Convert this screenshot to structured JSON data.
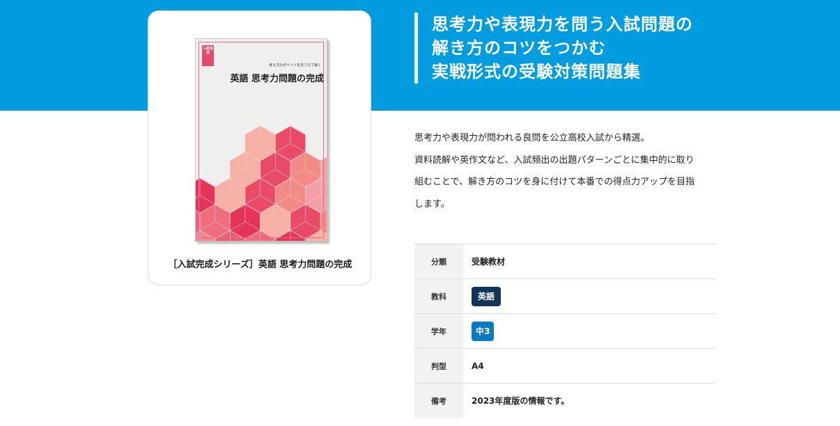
{
  "headline": {
    "lines": [
      "思考力や表現力を問う入試問題の",
      "解き方のコツをつかむ",
      "実戦形式の受験対策問題集"
    ]
  },
  "product": {
    "caption": "［入試完成シリーズ］英語 思考力問題の完成",
    "cover": {
      "series_badge": "入試完成",
      "subtitle": "考え方のポイントをおさえて解く",
      "title": "英語  思考力問題の完成"
    }
  },
  "description": {
    "lines": [
      "思考力や表現力が問われる良問を公立高校入試から精選。",
      "資料読解や英作文など、入試頻出の出題パターンごとに集中的に取り",
      "組むことで、解き方のコツを身に付けて本番での得点力アップを目指",
      "します。"
    ]
  },
  "specs": {
    "category": {
      "label": "分類",
      "value": "受験教材"
    },
    "subject": {
      "label": "教科",
      "value": "英語"
    },
    "grade": {
      "label": "学年",
      "value": "中3"
    },
    "format": {
      "label": "判型",
      "value": "A4"
    },
    "remarks": {
      "label": "備考",
      "value": "2023年度版の情報です。"
    }
  },
  "colors": {
    "brand_blue": "#009ce0",
    "subject_tag": "#123458",
    "grade_tag": "#0b79c4",
    "cover_accent": "#e34a6c"
  }
}
